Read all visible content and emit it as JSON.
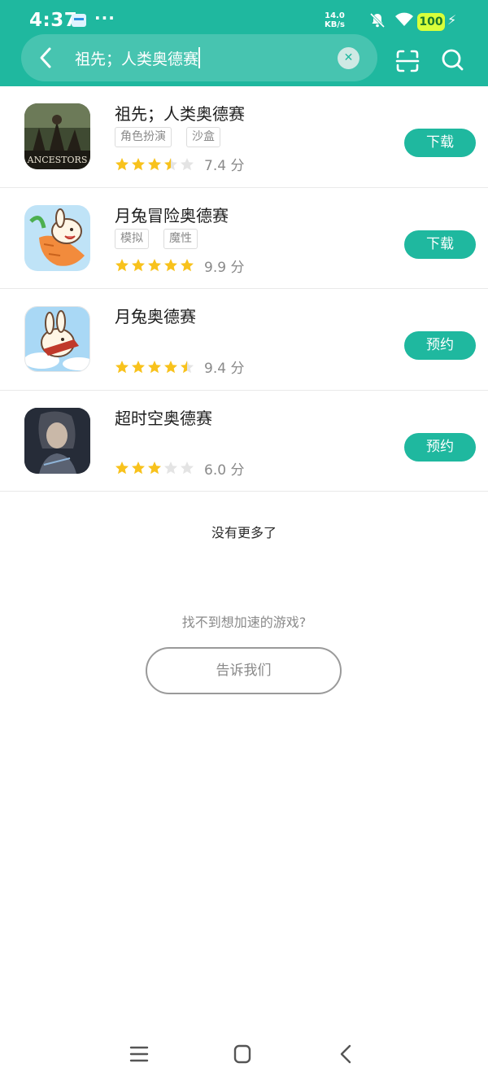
{
  "status_bar": {
    "time": "4:37",
    "more": "···",
    "speed_value": "14.0",
    "speed_unit": "KB/s",
    "battery": "100"
  },
  "search": {
    "query": "祖先；人类奥德赛"
  },
  "results": [
    {
      "name": "祖先；人类奥德赛",
      "tags": [
        "角色扮演",
        "沙盒"
      ],
      "rating_stars": 3.5,
      "score": "7.4 分",
      "action": "下载"
    },
    {
      "name": "月兔冒险奥德赛",
      "tags": [
        "模拟",
        "魔性"
      ],
      "rating_stars": 5,
      "score": "9.9 分",
      "action": "下载"
    },
    {
      "name": "月兔奥德赛",
      "tags": [],
      "rating_stars": 4.5,
      "score": "9.4 分",
      "action": "预约"
    },
    {
      "name": "超时空奥德赛",
      "tags": [],
      "rating_stars": 3,
      "score": "6.0 分",
      "action": "预约"
    }
  ],
  "footer": {
    "no_more": "没有更多了",
    "cant_find": "找不到想加速的游戏?",
    "tell_us": "告诉我们"
  },
  "colors": {
    "brand": "#1fb89f",
    "star": "#f8c21c",
    "star_empty": "#e4e4e4"
  },
  "icons": {
    "back": "chevron-left-icon",
    "clear": "close-icon",
    "scan": "scan-icon",
    "search": "search-icon",
    "nav_menu": "menu-icon",
    "nav_home": "home-square-icon",
    "nav_back": "back-icon"
  }
}
